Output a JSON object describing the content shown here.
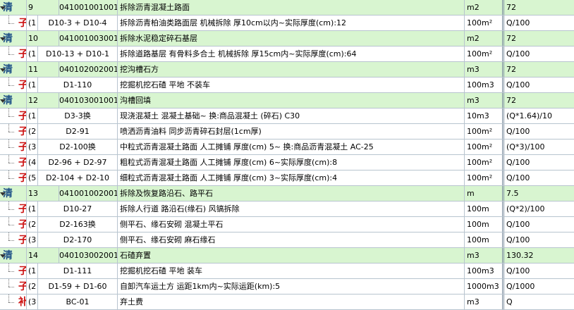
{
  "rows": [
    {
      "type": "清",
      "index": "9",
      "code": "041001001001",
      "name": "拆除沥青混凝土路面",
      "unit": "m2",
      "qty": "72"
    },
    {
      "type": "子",
      "index": "(1",
      "code": "D10-3 + D10-4",
      "name": "拆除沥青柏油类路面层 机械拆除 厚10cm以内~实际厚度(cm):12",
      "unit": "100m²",
      "qty": "Q/100"
    },
    {
      "type": "清",
      "index": "10",
      "code": "041001003001",
      "name": "拆除水泥稳定碎石基层",
      "unit": "m2",
      "qty": "72"
    },
    {
      "type": "子",
      "index": "(1",
      "code": "D10-13 + D10-1",
      "name": "拆除道路基层 有骨料多合土 机械拆除 厚15cm内~实际厚度(cm):64",
      "unit": "100m²",
      "qty": "Q/100"
    },
    {
      "type": "清",
      "index": "11",
      "code": "040102002001",
      "name": "挖沟槽石方",
      "unit": "m3",
      "qty": "72"
    },
    {
      "type": "子",
      "index": "(1",
      "code": "D1-110",
      "name": "挖掘机挖石碴 平地 不装车",
      "unit": "100m3",
      "qty": "Q/100"
    },
    {
      "type": "清",
      "index": "12",
      "code": "040103001001",
      "name": "沟槽回填",
      "unit": "m3",
      "qty": "72"
    },
    {
      "type": "子",
      "index": "(1",
      "code": "D3-3换",
      "name": "现浇混凝土 混凝土基础~ 换:商品混凝土 (碎石) C30",
      "unit": "10m3",
      "qty": "(Q*1.64)/10"
    },
    {
      "type": "子",
      "index": "(2",
      "code": "D2-91",
      "name": "喷洒沥青油料 同步沥青碎石封层(1cm厚)",
      "unit": "100m²",
      "qty": "Q/100"
    },
    {
      "type": "子",
      "index": "(3",
      "code": "D2-100换",
      "name": "中粒式沥青混凝土路面 人工摊铺 厚度(cm) 5~ 换:商品沥青混凝土 AC-25",
      "unit": "100m²",
      "qty": "(Q*3)/100"
    },
    {
      "type": "子",
      "index": "(4",
      "code": "D2-96 + D2-97",
      "name": "粗粒式沥青混凝土路面 人工摊铺 厚度(cm) 6~实际厚度(cm):8",
      "unit": "100m²",
      "qty": "Q/100"
    },
    {
      "type": "子",
      "index": "(5",
      "code": "D2-104 + D2-10",
      "name": "细粒式沥青混凝土路面 人工摊铺 厚度(cm) 3~实际厚度(cm):4",
      "unit": "100m²",
      "qty": "Q/100"
    },
    {
      "type": "清",
      "index": "13",
      "code": "041001002001",
      "name": "拆除及恢复路沿石、路平石",
      "unit": "m",
      "qty": "7.5"
    },
    {
      "type": "子",
      "index": "(1",
      "code": "D10-27",
      "name": "拆除人行道 路沿石(缘石) 风镐拆除",
      "unit": "100m",
      "qty": "(Q*2)/100"
    },
    {
      "type": "子",
      "index": "(2",
      "code": "D2-163换",
      "name": "侧平石、缘石安砌 混凝土平石",
      "unit": "100m",
      "qty": "Q/100"
    },
    {
      "type": "子",
      "index": "(3",
      "code": "D2-170",
      "name": "侧平石、缘石安砌 麻石缘石",
      "unit": "100m",
      "qty": "Q/100"
    },
    {
      "type": "清",
      "index": "14",
      "code": "040103002001",
      "name": "石碴弃置",
      "unit": "m3",
      "qty": "130.32"
    },
    {
      "type": "子",
      "index": "(1",
      "code": "D1-111",
      "name": "挖掘机挖石碴 平地 装车",
      "unit": "100m3",
      "qty": "Q/100"
    },
    {
      "type": "子",
      "index": "(2",
      "code": "D1-59 + D1-60",
      "name": "自卸汽车运土方 运距1km内~实际运距(km):5",
      "unit": "1000m3",
      "qty": "Q/1000"
    },
    {
      "type": "补",
      "index": "(3",
      "code": "BC-01",
      "name": "弃土费",
      "unit": "m3",
      "qty": "Q"
    }
  ],
  "colors": {
    "qing_row_bg": "#d8f5d0",
    "qing_char": "#1c4f86",
    "zi_char": "#cc1111",
    "grid_line": "#b8c4cf"
  }
}
